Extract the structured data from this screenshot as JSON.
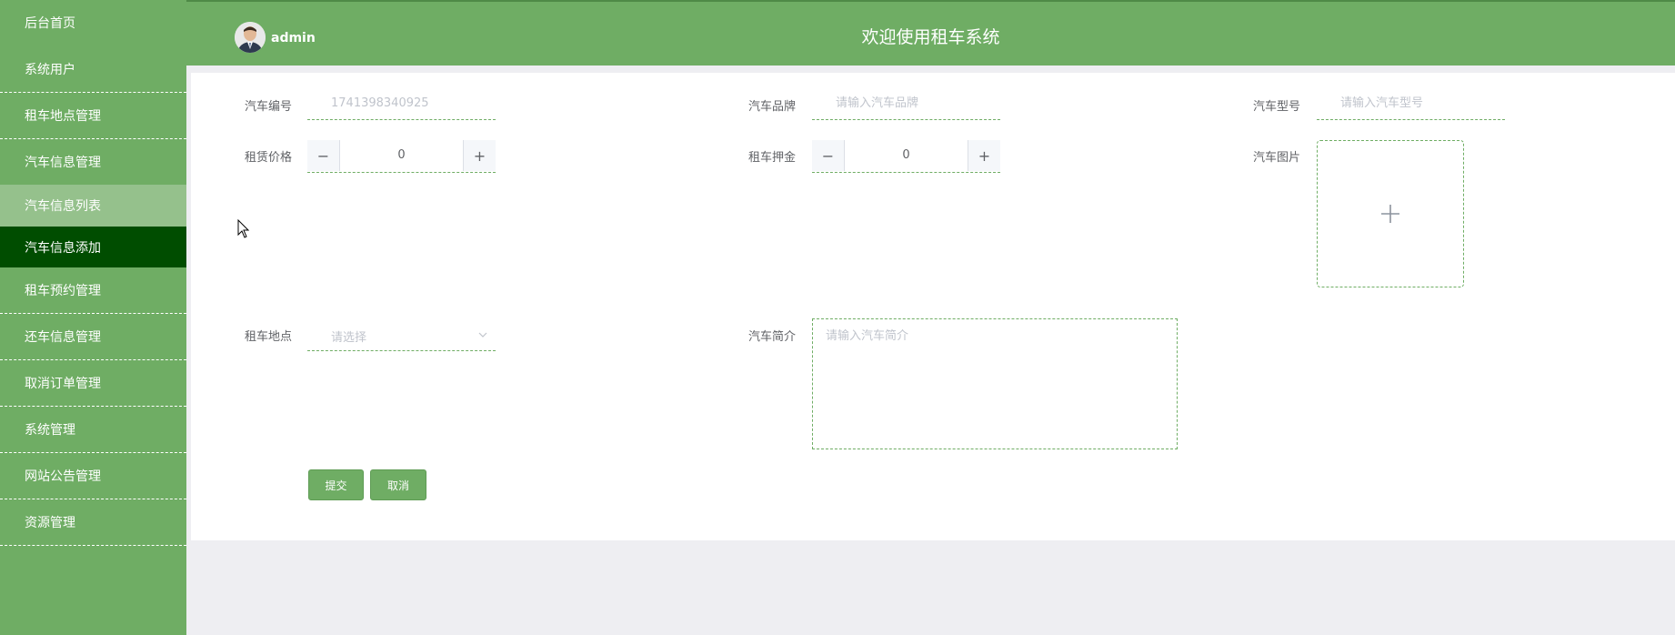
{
  "sidebar": {
    "items": [
      {
        "label": "后台首页"
      },
      {
        "label": "系统用户"
      },
      {
        "label": "租车地点管理"
      },
      {
        "label": "汽车信息管理"
      },
      {
        "label": "汽车信息列表"
      },
      {
        "label": "汽车信息添加"
      },
      {
        "label": "租车预约管理"
      },
      {
        "label": "还车信息管理"
      },
      {
        "label": "取消订单管理"
      },
      {
        "label": "系统管理"
      },
      {
        "label": "网站公告管理"
      },
      {
        "label": "资源管理"
      }
    ]
  },
  "header": {
    "username": "admin",
    "title": "欢迎使用租车系统"
  },
  "form": {
    "car_number": {
      "label": "汽车编号",
      "value": "1741398340925"
    },
    "car_brand": {
      "label": "汽车品牌",
      "placeholder": "请输入汽车品牌"
    },
    "car_model": {
      "label": "汽车型号",
      "placeholder": "请输入汽车型号"
    },
    "rent_price": {
      "label": "租赁价格",
      "value": "0"
    },
    "rent_deposit": {
      "label": "租车押金",
      "value": "0"
    },
    "car_image": {
      "label": "汽车图片"
    },
    "rent_location": {
      "label": "租车地点",
      "placeholder": "请选择"
    },
    "car_intro": {
      "label": "汽车简介",
      "placeholder": "请输入汽车简介"
    },
    "submit_label": "提交",
    "cancel_label": "取消"
  },
  "colors": {
    "primary": "#6fad64",
    "active_menu": "#004d00",
    "hover_menu": "#95c18c",
    "background": "#eeeef2"
  }
}
